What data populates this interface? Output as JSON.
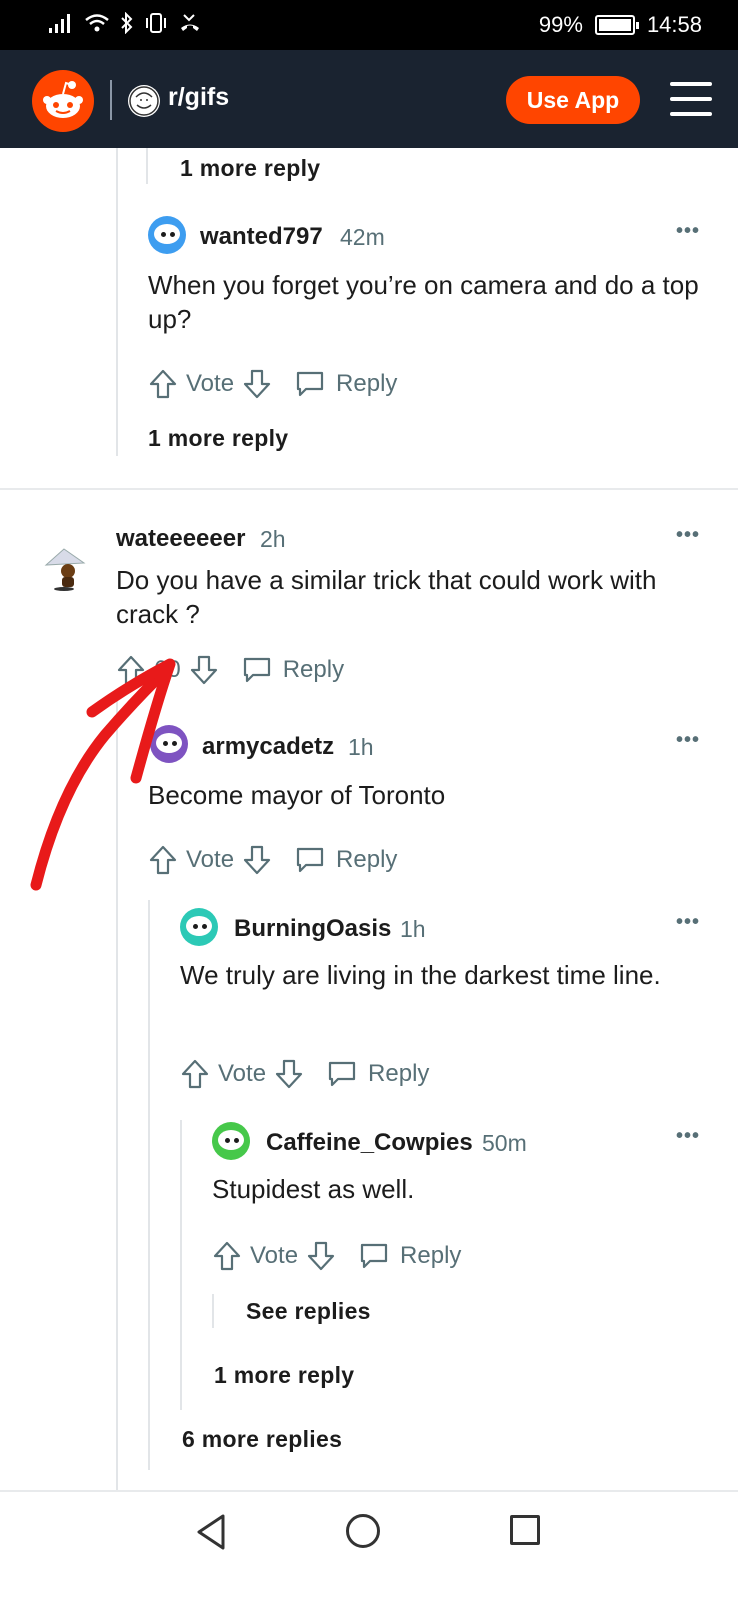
{
  "status_bar": {
    "battery": "99%",
    "battery_level": 0.99,
    "time": "14:58"
  },
  "header": {
    "subreddit": "r/gifs",
    "use_app_label": "Use App"
  },
  "colors": {
    "brand": "#ff4500",
    "header_bg": "#1a2330",
    "text": "#1c1c1c",
    "meta": "#576f76",
    "annotation_arrow": "#e81a1a"
  },
  "top_more_reply": "1 more reply",
  "comments": [
    {
      "username": "wanted797",
      "age": "42m",
      "text": "When you forget you’re on camera and do a top up?",
      "vote_label": "Vote",
      "reply_label": "Reply",
      "more_replies": "1 more reply"
    },
    {
      "username": "wateeeeeer",
      "age": "2h",
      "text": "Do you have a similar trick that could work with crack ?",
      "vote_label": "60",
      "reply_label": "Reply"
    },
    {
      "username": "armycadetz",
      "age": "1h",
      "text": "Become mayor of Toronto",
      "vote_label": "Vote",
      "reply_label": "Reply"
    },
    {
      "username": "BurningOasis",
      "age": "1h",
      "text": "We truly are living in the darkest time line.",
      "vote_label": "Vote",
      "reply_label": "Reply"
    },
    {
      "username": "Caffeine_Cowpies",
      "age": "50m",
      "text": "Stupidest as well.",
      "vote_label": "Vote",
      "reply_label": "Reply",
      "see_replies": "See replies"
    }
  ],
  "burning_more_reply": "1 more reply",
  "army_more_replies": "6 more replies",
  "more_icon": "ellipsis-icon",
  "nav": {
    "back_icon": "back-triangle-icon",
    "home_icon": "home-circle-icon",
    "recent_icon": "recent-square-icon"
  }
}
